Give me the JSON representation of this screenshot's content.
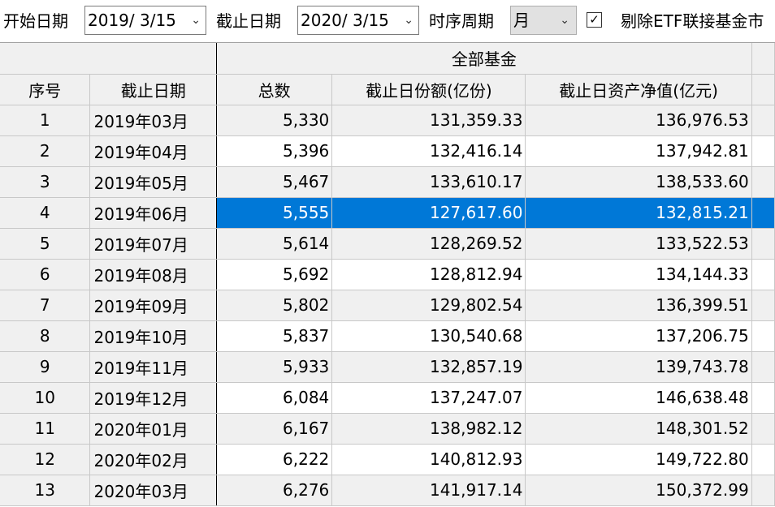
{
  "toolbar": {
    "start_label": "开始日期",
    "start_date": "2019/  3/15",
    "end_label": "截止日期",
    "end_date": "2020/  3/15",
    "period_label": "时序周期",
    "period_value": "月",
    "exclude_checked": true,
    "exclude_label": "剔除ETF联接基金市"
  },
  "table": {
    "group_header": "全部基金",
    "columns": [
      "序号",
      "截止日期",
      "总数",
      "截止日份额(亿份)",
      "截止日资产净值(亿元)"
    ],
    "selected_row": 3,
    "rows": [
      [
        "1",
        "2019年03月",
        "5,330",
        "131,359.33",
        "136,976.53"
      ],
      [
        "2",
        "2019年04月",
        "5,396",
        "132,416.14",
        "137,942.81"
      ],
      [
        "3",
        "2019年05月",
        "5,467",
        "133,610.17",
        "138,533.60"
      ],
      [
        "4",
        "2019年06月",
        "5,555",
        "127,617.60",
        "132,815.21"
      ],
      [
        "5",
        "2019年07月",
        "5,614",
        "128,269.52",
        "133,522.53"
      ],
      [
        "6",
        "2019年08月",
        "5,692",
        "128,812.94",
        "134,144.33"
      ],
      [
        "7",
        "2019年09月",
        "5,802",
        "129,802.54",
        "136,399.51"
      ],
      [
        "8",
        "2019年10月",
        "5,837",
        "130,540.68",
        "137,206.75"
      ],
      [
        "9",
        "2019年11月",
        "5,933",
        "132,857.19",
        "139,743.78"
      ],
      [
        "10",
        "2019年12月",
        "6,084",
        "137,247.07",
        "146,638.48"
      ],
      [
        "11",
        "2020年01月",
        "6,167",
        "138,982.12",
        "148,301.52"
      ],
      [
        "12",
        "2020年02月",
        "6,222",
        "140,812.93",
        "149,722.80"
      ],
      [
        "13",
        "2020年03月",
        "6,276",
        "141,917.14",
        "150,372.99"
      ]
    ]
  }
}
